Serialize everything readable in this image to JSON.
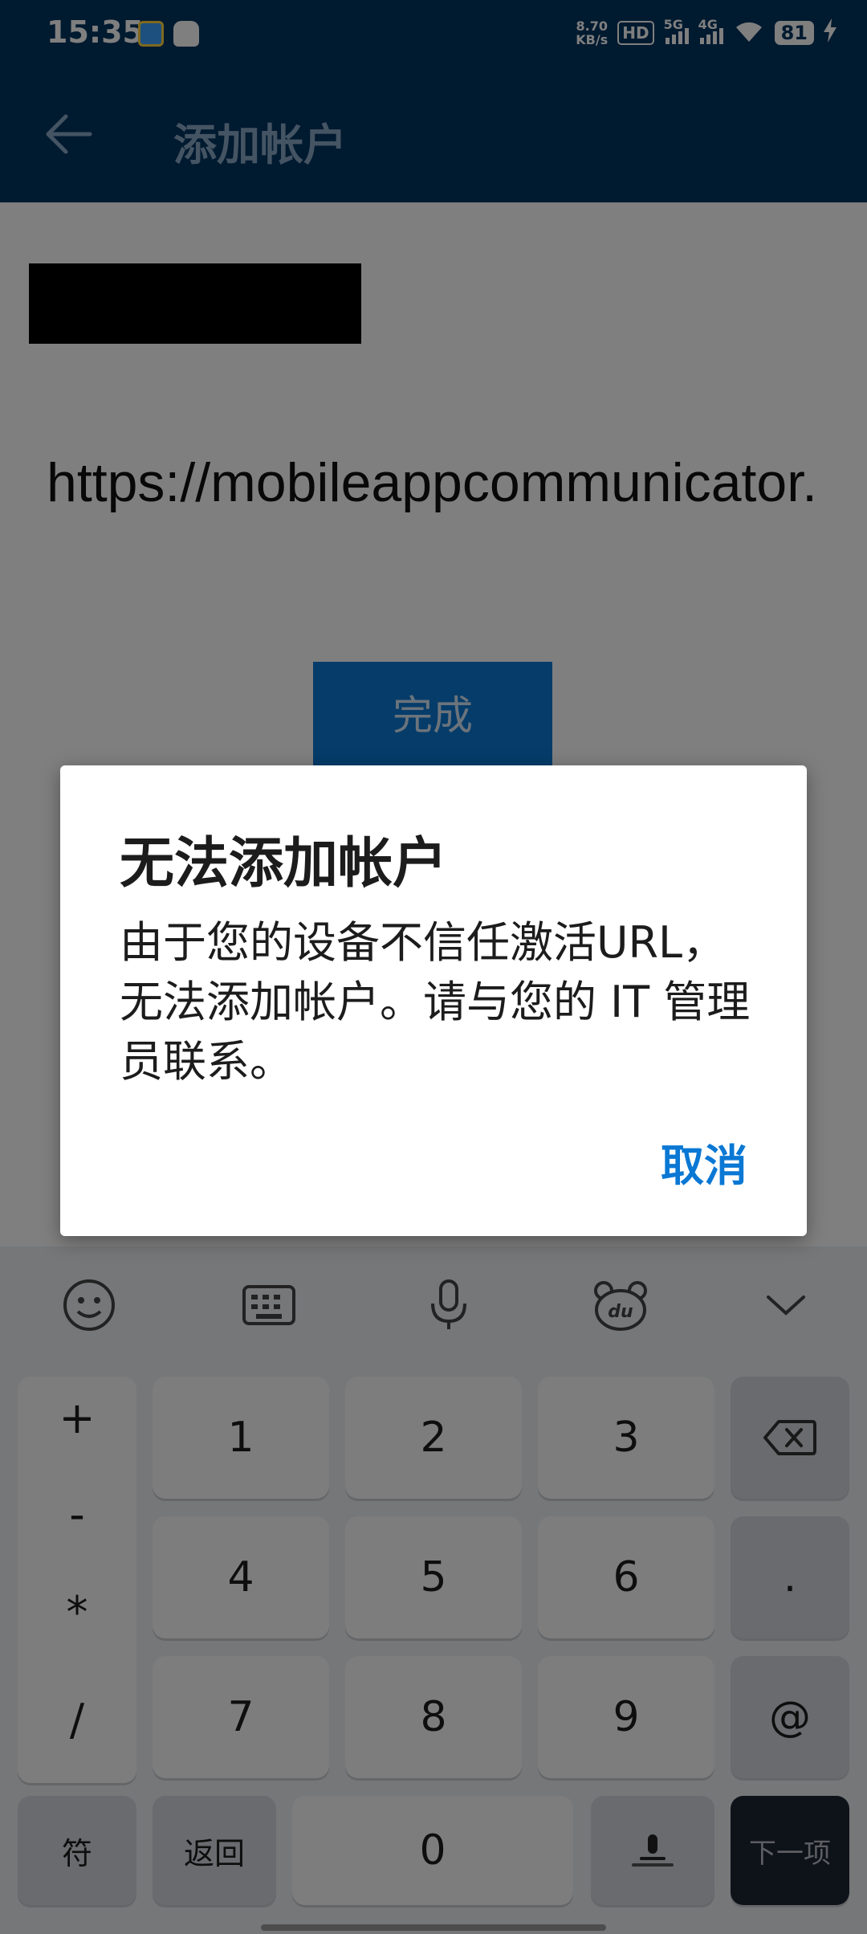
{
  "status_bar": {
    "time": "15:35",
    "net_speed_value": "8.70",
    "net_speed_unit": "KB/s",
    "hd_label": "HD",
    "sim1_label": "5G",
    "sim2_label": "4G",
    "battery": "81"
  },
  "app_bar": {
    "title": "添加帐户"
  },
  "form": {
    "url_value": "https://mobileappcommunicator.example",
    "done_label": "完成"
  },
  "dialog": {
    "title": "无法添加帐户",
    "message": "由于您的设备不信任激活URL，无法添加帐户。请与您的 IT 管理员联系。",
    "cancel_label": "取消"
  },
  "keyboard": {
    "symbols": [
      "+",
      "-",
      "*",
      "/"
    ],
    "rows": [
      [
        "1",
        "2",
        "3"
      ],
      [
        "4",
        "5",
        "6"
      ],
      [
        "7",
        "8",
        "9"
      ]
    ],
    "dot_key": ".",
    "at_key": "@",
    "symbol_key": "符",
    "back_key": "返回",
    "zero_key": "0",
    "next_key": "下一项"
  }
}
